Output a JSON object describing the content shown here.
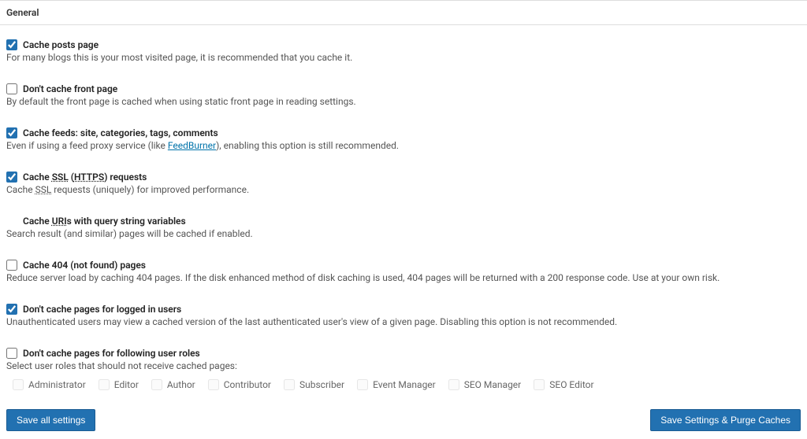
{
  "header": {
    "title": "General"
  },
  "settings": {
    "cache_posts": {
      "label": "Cache posts page",
      "desc_prefix": "For many blogs this is your most visited page, it is recommended that you cache it.",
      "checked": true
    },
    "dont_cache_front": {
      "label": "Don't cache front page",
      "desc_prefix": "By default the front page is cached when using static front page in reading settings.",
      "checked": false
    },
    "cache_feeds": {
      "label": "Cache feeds: site, categories, tags, comments",
      "desc_prefix": "Even if using a feed proxy service (like ",
      "link_text": "FeedBurner",
      "desc_suffix": "), enabling this option is still recommended.",
      "checked": true
    },
    "cache_ssl": {
      "label_prefix": "Cache ",
      "label_abbr1": "SSL",
      "label_mid": " (",
      "label_abbr2": "HTTPS",
      "label_suffix": ") requests",
      "desc_prefix": "Cache ",
      "desc_abbr": "SSL",
      "desc_suffix": " requests (uniquely) for improved performance.",
      "checked": true
    },
    "cache_query": {
      "label_prefix": "Cache ",
      "label_abbr": "URI",
      "label_suffix": "s with query string variables",
      "desc_prefix": "Search result (and similar) pages will be cached if enabled.",
      "checked": false
    },
    "cache_404": {
      "label": "Cache 404 (not found) pages",
      "desc_prefix": "Reduce server load by caching 404 pages. If the disk enhanced method of disk caching is used, 404 pages will be returned with a 200 response code. Use at your own risk.",
      "checked": false
    },
    "dont_cache_logged": {
      "label": "Don't cache pages for logged in users",
      "desc_prefix": "Unauthenticated users may view a cached version of the last authenticated user's view of a given page. Disabling this option is not recommended.",
      "checked": true
    },
    "dont_cache_roles": {
      "label": "Don't cache pages for following user roles",
      "desc_prefix": "Select user roles that should not receive cached pages:",
      "checked": false
    }
  },
  "roles": [
    "Administrator",
    "Editor",
    "Author",
    "Contributor",
    "Subscriber",
    "Event Manager",
    "SEO Manager",
    "SEO Editor"
  ],
  "buttons": {
    "save": "Save all settings",
    "save_purge": "Save Settings & Purge Caches"
  }
}
